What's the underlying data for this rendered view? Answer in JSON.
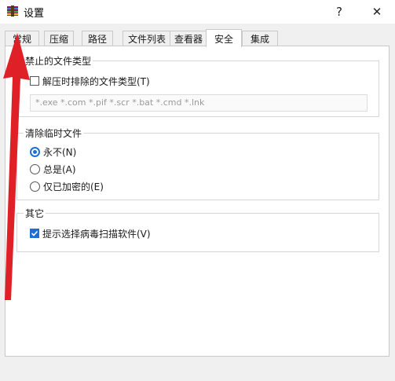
{
  "window": {
    "title": "设置",
    "help_label": "?",
    "close_label": "✕"
  },
  "tabs": [
    {
      "label": "常规",
      "active": false
    },
    {
      "label": "压缩",
      "active": false
    },
    {
      "label": "路径",
      "active": false
    },
    {
      "label": "文件列表",
      "active": false
    },
    {
      "label": "查看器",
      "active": false
    },
    {
      "label": "安全",
      "active": true
    },
    {
      "label": "集成",
      "active": false
    }
  ],
  "security": {
    "forbidden_group": {
      "title": "禁止的文件类型",
      "exclude_checkbox_label": "解压时排除的文件类型(T)",
      "exclude_checked": false,
      "extensions_value": "*.exe *.com *.pif *.scr *.bat *.cmd *.lnk"
    },
    "temp_group": {
      "title": "清除临时文件",
      "options": [
        {
          "label": "永不(N)",
          "checked": true
        },
        {
          "label": "总是(A)",
          "checked": false
        },
        {
          "label": "仅已加密的(E)",
          "checked": false
        }
      ]
    },
    "other_group": {
      "title": "其它",
      "virus_scan_label": "提示选择病毒扫描软件(V)",
      "virus_scan_checked": true
    }
  },
  "colors": {
    "accent": "#1f6fd1",
    "arrow": "#e02027"
  }
}
